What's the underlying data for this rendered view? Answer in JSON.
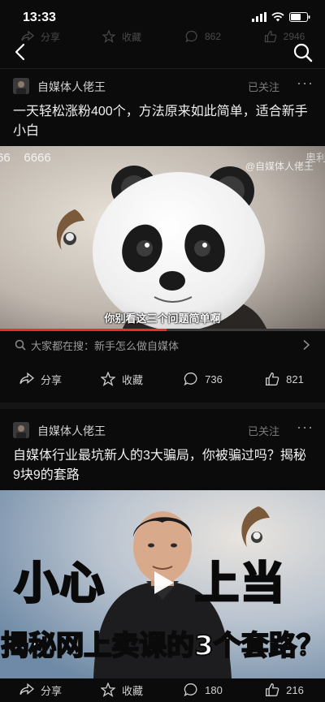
{
  "status": {
    "time": "13:33"
  },
  "faded_top_actions": {
    "share": "分享",
    "collect": "收藏",
    "comments": "862",
    "likes": "2946"
  },
  "card1": {
    "author": "自媒体人佬王",
    "follow_status": "已关注",
    "title": "一天轻松涨粉400个，方法原来如此简单，适合新手小白",
    "video_overlay_left": "66    6666",
    "video_watermark": "@自媒体人佬王",
    "video_corner_text": "奥利",
    "video_subtitle": "你别看这三个问题简单啊",
    "related_search": "大家都在搜：新手怎么做自媒体",
    "actions": {
      "share": "分享",
      "collect": "收藏",
      "comments": "736",
      "likes": "821"
    }
  },
  "card2": {
    "author": "自媒体人佬王",
    "follow_status": "已关注",
    "title": "自媒体行业最坑新人的3大骗局，你被骗过吗？揭秘9块9的套路",
    "big_text_left": "小心",
    "big_text_right": "上当",
    "banner_text": "揭秘网上卖课的3个套路？",
    "actions": {
      "share": "分享",
      "collect": "收藏",
      "comments": "180",
      "likes": "216"
    }
  },
  "colors": {
    "background": "#0b0b0b",
    "accent_orange": "#f28b2c",
    "progress_red": "#e0332f",
    "banner_outline": "#0a0a0a"
  },
  "icons": [
    "back-icon",
    "search-icon",
    "share-icon",
    "star-icon",
    "comment-icon",
    "thumbs-up-icon",
    "more-icon",
    "play-icon",
    "chevron-right-icon"
  ]
}
